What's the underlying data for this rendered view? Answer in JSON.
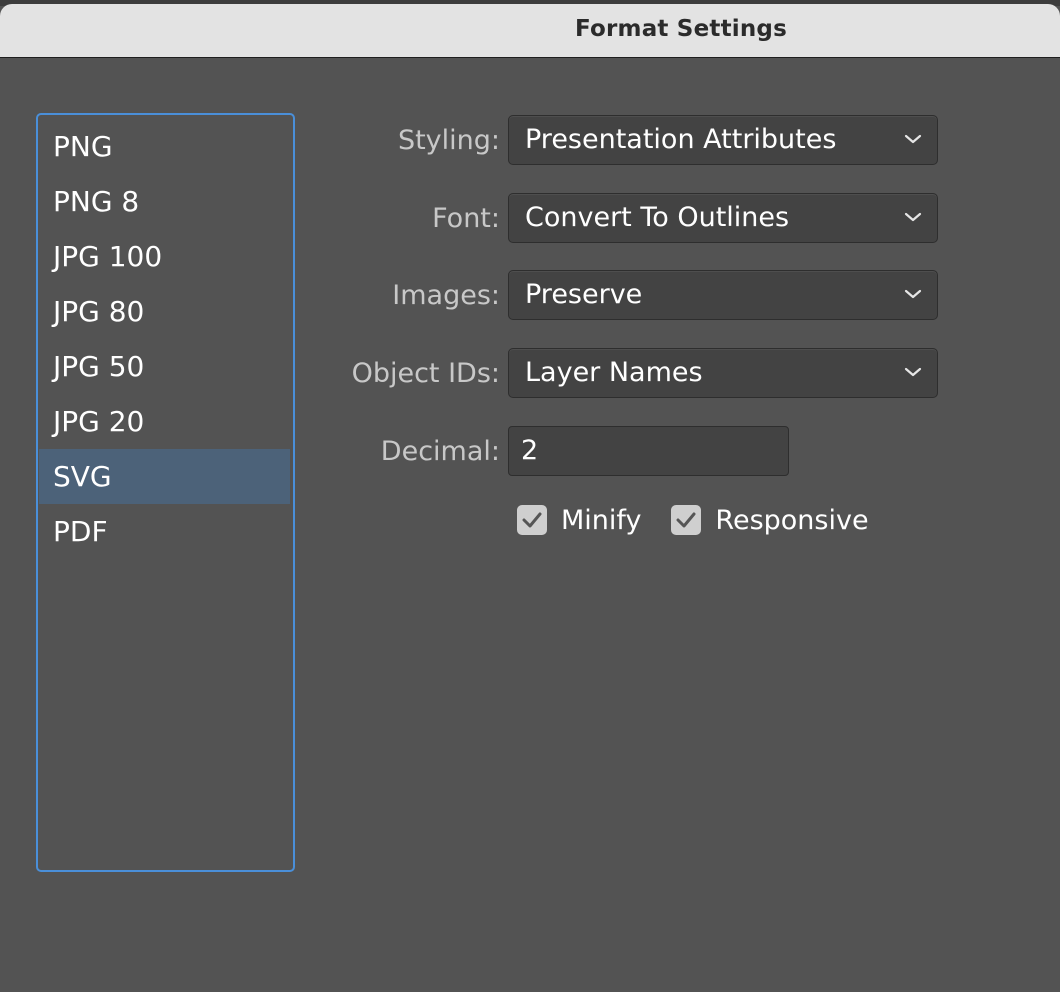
{
  "window": {
    "title": "Format Settings"
  },
  "formats": {
    "items": [
      "PNG",
      "PNG 8",
      "JPG 100",
      "JPG 80",
      "JPG 50",
      "JPG 20",
      "SVG",
      "PDF"
    ],
    "selected": "SVG"
  },
  "settings": {
    "styling": {
      "label": "Styling:",
      "value": "Presentation Attributes"
    },
    "font": {
      "label": "Font:",
      "value": "Convert To Outlines"
    },
    "images": {
      "label": "Images:",
      "value": "Preserve"
    },
    "object_ids": {
      "label": "Object IDs:",
      "value": "Layer Names"
    },
    "decimal": {
      "label": "Decimal:",
      "value": "2"
    },
    "minify": {
      "label": "Minify",
      "checked": true
    },
    "responsive": {
      "label": "Responsive",
      "checked": true
    }
  },
  "colors": {
    "background": "#535353",
    "list_border": "#4a8fd9",
    "selection": "#4c6279",
    "titlebar": "#e3e3e3"
  },
  "icons": {
    "dropdown": "chevron-down-icon",
    "check": "checkmark-icon"
  }
}
